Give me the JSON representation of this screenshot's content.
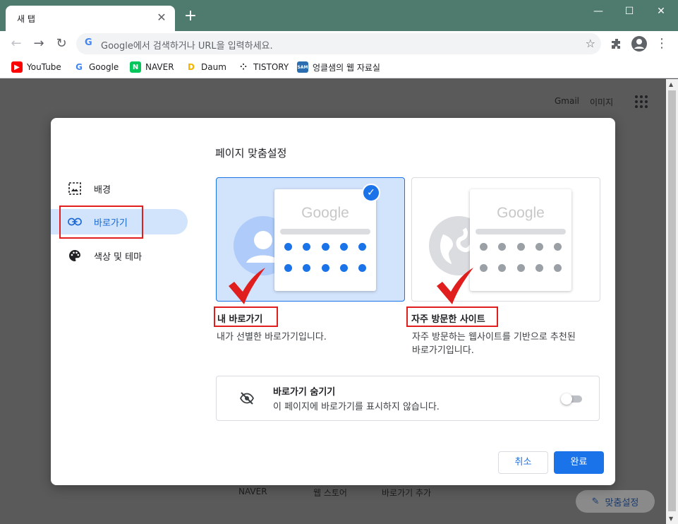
{
  "browser": {
    "tab_title": "새 탭",
    "omnibox_placeholder": "Google에서 검색하거나 URL을 입력하세요.",
    "bookmarks": [
      {
        "label": "YouTube",
        "color": "#ff0000"
      },
      {
        "label": "Google",
        "color": "#4285f4"
      },
      {
        "label": "NAVER",
        "color": "#03c75a"
      },
      {
        "label": "Daum",
        "color": "#f4b400"
      },
      {
        "label": "TISTORY",
        "color": "#202124"
      },
      {
        "label": "엉클샘의 웹 자료실",
        "color": "#2a6db0"
      }
    ]
  },
  "page": {
    "gmail": "Gmail",
    "images": "이미지",
    "shortcut_naver": "NAVER",
    "shortcut_webstore": "웹 스토어",
    "shortcut_add": "바로가기 추가",
    "customize_button": "맞춤설정"
  },
  "dialog": {
    "title": "페이지 맞춤설정",
    "sidebar": [
      {
        "label": "배경",
        "icon": "background-icon",
        "active": false
      },
      {
        "label": "바로가기",
        "icon": "link-icon",
        "active": true
      },
      {
        "label": "색상 및 테마",
        "icon": "palette-icon",
        "active": false
      }
    ],
    "option_my_shortcuts": {
      "title": "내 바로가기",
      "description": "내가 선별한 바로가기입니다.",
      "selected": true,
      "preview_text": "Google"
    },
    "option_most_visited": {
      "title": "자주 방문한 사이트",
      "description_line1": "자주 방문하는 웹사이트를 기반으로 추천된",
      "description_line2": "바로가기입니다.",
      "selected": false,
      "preview_text": "Google"
    },
    "hide_shortcuts": {
      "title": "바로가기 숨기기",
      "description": "이 페이지에 바로가기를 표시하지 않습니다.",
      "enabled": false
    },
    "cancel_label": "취소",
    "done_label": "완료"
  },
  "colors": {
    "accent": "#1a73e8",
    "selected_bg": "#d2e3fc",
    "annotation_red": "#e01e1e"
  }
}
